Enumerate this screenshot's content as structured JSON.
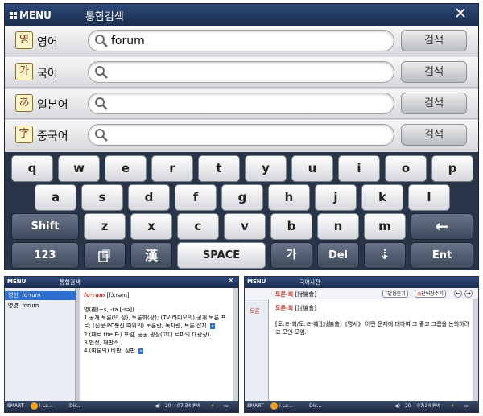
{
  "main": {
    "menu_label": "MENU",
    "title": "통합검색",
    "close": "✕",
    "rows": [
      {
        "icon": "영",
        "label": "영어",
        "value": "forum",
        "button": "검색"
      },
      {
        "icon": "가",
        "label": "국어",
        "value": "",
        "button": "검색"
      },
      {
        "icon": "あ",
        "label": "일본어",
        "value": "",
        "button": "검색"
      },
      {
        "icon": "字",
        "label": "중국어",
        "value": "",
        "button": "검색"
      }
    ],
    "keys_row1": [
      "q",
      "w",
      "e",
      "r",
      "t",
      "y",
      "u",
      "i",
      "o",
      "p"
    ],
    "keys_row2": [
      "a",
      "s",
      "d",
      "f",
      "g",
      "h",
      "j",
      "k",
      "l"
    ],
    "shift": "Shift",
    "keys_row3": [
      "z",
      "x",
      "c",
      "v",
      "b",
      "n",
      "m"
    ],
    "backspace": "←",
    "num": "123",
    "hanja": "漢",
    "space": "SPACE",
    "hangul": "가",
    "del": "Del",
    "down": "⇣",
    "ent": "Ent"
  },
  "left_win": {
    "menu_label": "MENU",
    "title": "통합검색",
    "close": "✕",
    "results": [
      {
        "lang": "영한",
        "word": "fo·rum"
      },
      {
        "lang": "영영",
        "word": "forum"
      }
    ],
    "headword": "fo·rum",
    "pron": "[fɔ́:rəm]",
    "pos": "명(複)~s, -ra [-rə])",
    "def1": "1 공개 토론(의 장), 토론회(장); (TV·라디오의) 공개 토론 프로; (신문·PC통신 따위의) 토론란, 독자란, 토론 잡지.",
    "def2": "2 (때로 the F-) 포럼, 공공 광장(고대 로마의 대광장).",
    "def3": "3 법정, 재판소.",
    "def4": "4 (여론의) 비판, 심판.",
    "tray": {
      "smart": "SMART",
      "app": "i-La...",
      "dic": "Dic...",
      "vol": "20",
      "time": "07:34 PM"
    }
  },
  "right_win": {
    "menu_label": "MENU",
    "title": "국어사전",
    "btn_pron": "발음듣기",
    "btn_save": "단어장수기",
    "sidebar_item": "토론",
    "entry": "토론-회",
    "entry_hanja": "[討論會]",
    "entry2": "토론-회",
    "entry2_hanja": "[討論會]",
    "def": "[토:ㄹ-회/토:ㄹ-훼][討論會]《명사》 어떤 문제에 대하여 그 좋고 그름을 논의하려고 모인 모임.",
    "tray": {
      "smart": "SMART",
      "app": "i-La...",
      "dic": "Dic...",
      "vol": "20",
      "time": "07:34 PM"
    }
  },
  "colors": {
    "title": "#1b2d4e",
    "accent": "#c0392b",
    "highlight": "#2f6fd1"
  }
}
